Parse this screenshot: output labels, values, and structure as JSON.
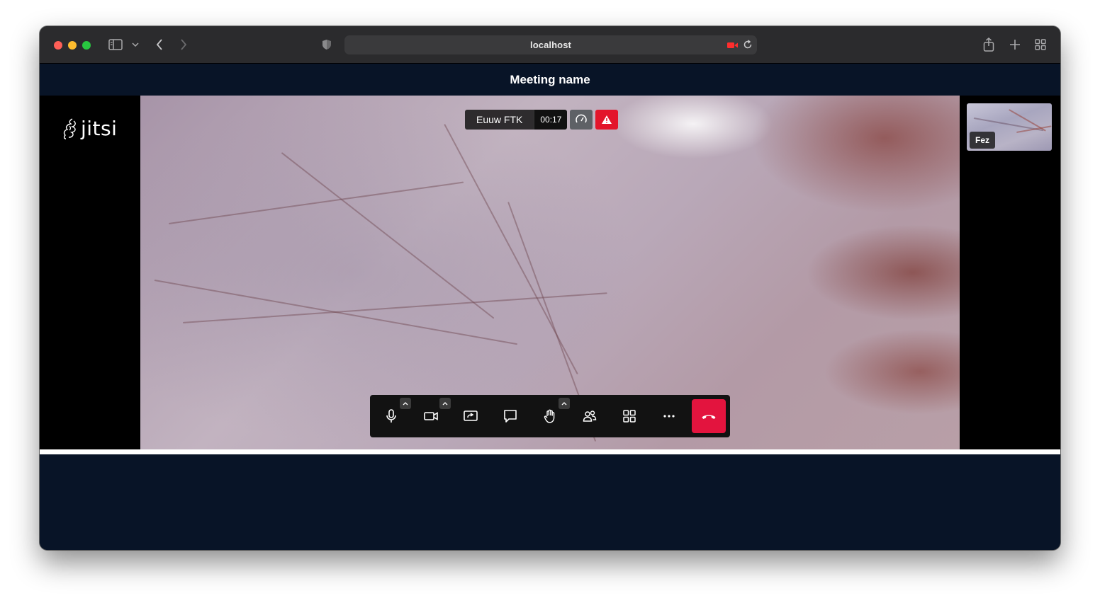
{
  "browser": {
    "url": "localhost",
    "icons": {
      "sidebar": "sidebar-icon",
      "chevron": "chevron-down-icon",
      "back": "back-arrow-icon",
      "forward": "forward-arrow-icon",
      "privacy": "shield-icon",
      "camera": "camera-recording-icon",
      "reload": "reload-icon",
      "share": "share-icon",
      "new_tab": "plus-icon",
      "tabs": "tab-overview-icon"
    }
  },
  "meeting": {
    "title": "Meeting name",
    "logo_text": "jitsi"
  },
  "stage": {
    "speaker_name": "Euuw FTK",
    "timer": "00:17",
    "thumbnail_name": "Fez"
  },
  "toolbar": {
    "buttons": [
      "microphone",
      "camera",
      "share-screen",
      "chat",
      "raise-hand",
      "participants",
      "tile-view",
      "more-actions",
      "hang-up"
    ]
  },
  "colors": {
    "accent_red": "#e3143e",
    "warning_red": "#e3152b",
    "background": "#081427"
  }
}
